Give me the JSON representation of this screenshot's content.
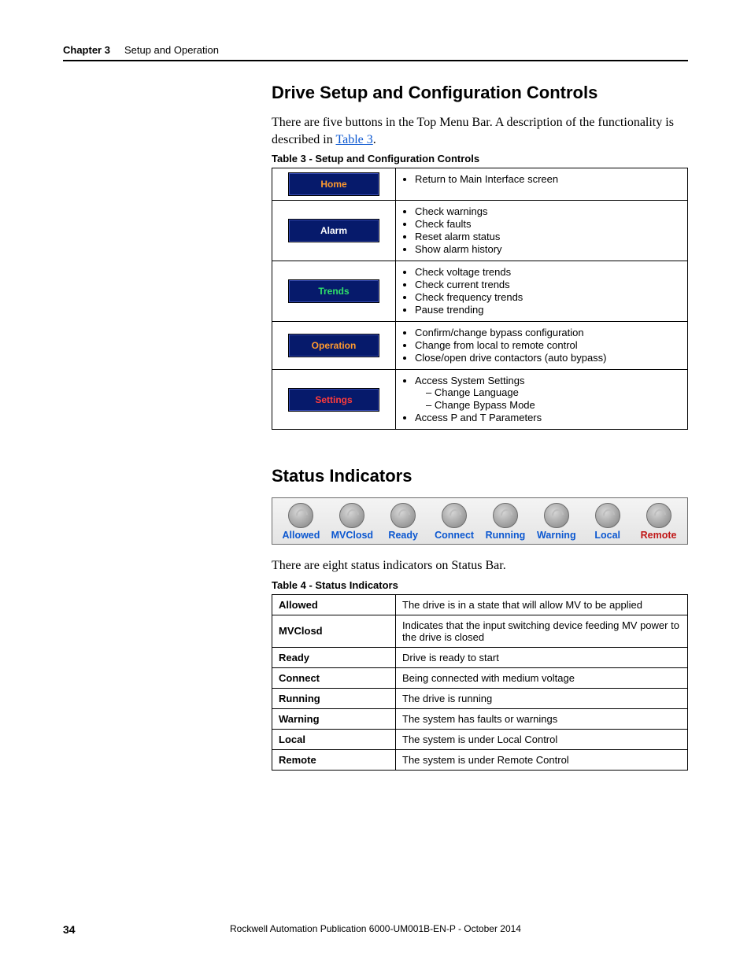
{
  "header": {
    "chapter_label": "Chapter 3",
    "chapter_title": "Setup and Operation"
  },
  "section1": {
    "title": "Drive Setup and Configuration Controls",
    "intro_pre": "There are five buttons in the Top Menu Bar. A description of the functionality is described in ",
    "intro_link": "Table 3",
    "intro_post": ".",
    "caption": "Table 3 - Setup and Configuration Controls",
    "rows": [
      {
        "btn": "Home",
        "color": "orange",
        "items": [
          "Return to Main Interface screen"
        ]
      },
      {
        "btn": "Alarm",
        "color": "white",
        "items": [
          "Check warnings",
          "Check faults",
          "Reset alarm status",
          "Show alarm history"
        ]
      },
      {
        "btn": "Trends",
        "color": "green",
        "items": [
          "Check voltage trends",
          "Check current trends",
          "Check frequency trends",
          "Pause trending"
        ]
      },
      {
        "btn": "Operation",
        "color": "orange",
        "items": [
          "Confirm/change bypass configuration",
          "Change from local to remote control",
          "Close/open drive contactors (auto bypass)"
        ]
      },
      {
        "btn": "Settings",
        "color": "red",
        "items": [
          "Access System Settings"
        ],
        "subitems": [
          "Change Language",
          "Change Bypass Mode"
        ],
        "items_after": [
          "Access P and T Parameters"
        ]
      }
    ]
  },
  "section2": {
    "title": "Status Indicators",
    "leds": [
      {
        "label": "Allowed",
        "color": "blue"
      },
      {
        "label": "MVClosd",
        "color": "blue"
      },
      {
        "label": "Ready",
        "color": "blue"
      },
      {
        "label": "Connect",
        "color": "blue"
      },
      {
        "label": "Running",
        "color": "blue"
      },
      {
        "label": "Warning",
        "color": "blue"
      },
      {
        "label": "Local",
        "color": "blue"
      },
      {
        "label": "Remote",
        "color": "red"
      }
    ],
    "intro": "There are eight status indicators on Status Bar.",
    "caption": "Table 4 - Status Indicators",
    "rows": [
      {
        "k": "Allowed",
        "v": "The drive is in a state that will allow MV to be applied"
      },
      {
        "k": "MVClosd",
        "v": "Indicates that the input switching device feeding MV power to the drive is closed"
      },
      {
        "k": "Ready",
        "v": "Drive is ready to start"
      },
      {
        "k": "Connect",
        "v": "Being connected with medium voltage"
      },
      {
        "k": "Running",
        "v": "The drive is running"
      },
      {
        "k": "Warning",
        "v": "The system has faults or warnings"
      },
      {
        "k": "Local",
        "v": "The system is under Local Control"
      },
      {
        "k": "Remote",
        "v": "The system is under Remote Control"
      }
    ]
  },
  "footer": {
    "page": "34",
    "pub": "Rockwell Automation Publication 6000-UM001B-EN-P - October 2014"
  }
}
